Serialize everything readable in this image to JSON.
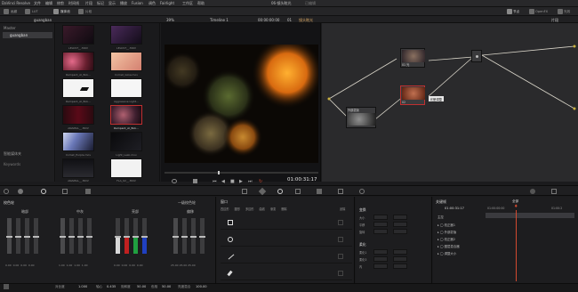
{
  "menubar": {
    "app": "DaVinci Resolve",
    "items": [
      "文件",
      "编辑",
      "修剪",
      "时间线",
      "片段",
      "标记",
      "显示",
      "播放",
      "Fusion",
      "调色",
      "Fairlight",
      "工作区",
      "帮助"
    ],
    "project_title": "06-镜头眩光",
    "project_state": "已编辑"
  },
  "toolbar": {
    "media_pool": "媒体池",
    "lut": "LUT",
    "left_items": [
      "画廊",
      "LUT",
      "媒体池",
      "片段"
    ],
    "right_items": [
      "节点",
      "OpenFX",
      "光效"
    ]
  },
  "subbar": {
    "bin_name": "guangban",
    "zoom": "39%",
    "timeline": "Timeline 1",
    "source_tc": "00:00:00:00",
    "clip": "01",
    "clip_name": "镜头眩光",
    "right_label": "片段"
  },
  "bins": {
    "master": "Master",
    "selected": "guangban",
    "smart_bins": "智能媒体夹",
    "keywords": "Keywords"
  },
  "thumbs": [
    {
      "label": "LELUST__.MOV"
    },
    {
      "label": "LELUST__.MOV"
    },
    {
      "label": "Rampant_Al_Bok..."
    },
    {
      "label": "Comet_Glow.mov"
    },
    {
      "label": "Rampant_Al_Bok..."
    },
    {
      "label": "Aggressive Light..."
    },
    {
      "label": "ANAMAL__.MOV"
    },
    {
      "label": "Rampant_Al_Bok..."
    },
    {
      "label": "Comet_Purple.mov"
    },
    {
      "label": "Light_Leak.mov"
    },
    {
      "label": "ANAMAL__.MOV"
    },
    {
      "label": "FLA_02__.MOV"
    }
  ],
  "viewer": {
    "timecode": "01:00:31:17"
  },
  "nodes": [
    {
      "label": "01 光",
      "type": "main"
    },
    {
      "label": "02",
      "type": "second"
    },
    {
      "label": "外部蒙版",
      "type": "external"
    }
  ],
  "node_tooltip": "光晕调整",
  "wheels": {
    "titles": [
      "暗部",
      "中灰",
      "亮部",
      "偏移"
    ],
    "mode": "一级校色轮",
    "values": [
      "0.00",
      "0.00",
      "0.00",
      "0.00",
      "1.00",
      "1.00",
      "1.00",
      "1.00",
      "0.00",
      "0.00",
      "0.00",
      "0.00",
      "25.00",
      "25.00",
      "25.00",
      "25.00"
    ]
  },
  "window": {
    "title": "窗口",
    "tools": [
      "四边形",
      "圆形",
      "多边形",
      "曲线",
      "渐变",
      "删除"
    ],
    "right_label": "滤除"
  },
  "transform": {
    "title": "变换",
    "size": "大小",
    "aspect": "宽高比",
    "pan": "平移",
    "tilt": "倾斜",
    "rotate": "旋转",
    "opacity": "不透明",
    "soft_title": "柔化",
    "soft1": "柔化1",
    "soft2": "柔化2",
    "soft3": "柔化3",
    "soft4": "柔化4",
    "inner": "内",
    "outer": "外"
  },
  "keyframes": {
    "title": "关键帧",
    "mode": "全部",
    "timecode": "01:00:31:17",
    "ruler_start": "01:00:00:00",
    "ruler_end": "01:00:2",
    "master": "主控",
    "rows": [
      "校正器1",
      "外部蒙版",
      "校正器2",
      "图层混合器",
      "调整大小"
    ]
  },
  "bottombar": {
    "contrast_label": "对比度",
    "contrast": "1.000",
    "pivot_label": "轴心",
    "pivot": "0.435",
    "sat_label": "饱和度",
    "sat": "50.00",
    "hue_label": "色相",
    "hue": "50.00",
    "lum_label": "亮度混合",
    "lum": "100.00"
  },
  "colors": {
    "accent": "#d24a30",
    "panel": "#1d1d1f",
    "node_bg": "#2a2a2c",
    "link": "#d8d4c8"
  }
}
